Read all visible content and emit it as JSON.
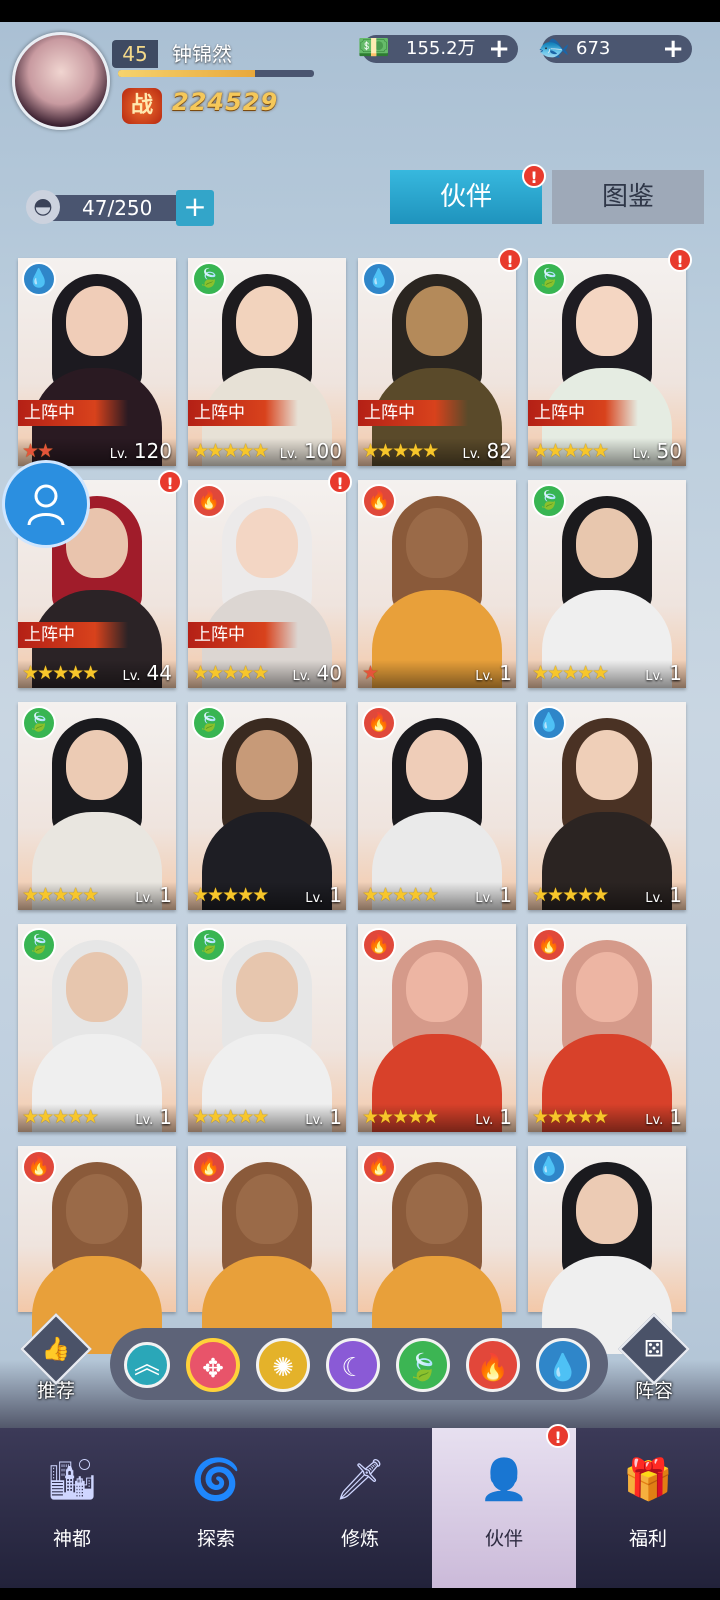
{
  "player": {
    "level": "45",
    "name": "钟锦然",
    "xp_fraction": 0.7,
    "power_icon": "战",
    "power": "224529"
  },
  "currencies": [
    {
      "icon": "cash-icon",
      "glyph": "💵",
      "value": "155.2万",
      "plus": "+"
    },
    {
      "icon": "fish-icon",
      "glyph": "🐟",
      "value": "673",
      "plus": "+"
    }
  ],
  "roster": {
    "count": "47/250",
    "add": "+"
  },
  "tabs": {
    "partner": "伙伴",
    "atlas": "图鉴",
    "partner_badge": "!"
  },
  "element_glyphs": {
    "water": "💧",
    "wood": "🍃",
    "fire": "🔥"
  },
  "deployed_label": "上阵中",
  "lv_prefix": "Lv.",
  "cards": [
    {
      "element": "water",
      "deployed": true,
      "stars": 2,
      "level": "120",
      "badge": false,
      "hair": "#1c1a20",
      "body": "#2a1a22",
      "skin": "#f0cdb8"
    },
    {
      "element": "wood",
      "deployed": true,
      "stars": 5,
      "level": "100",
      "badge": false,
      "hair": "#1d1b1e",
      "body": "#e7e1d6",
      "skin": "#f2d3bd"
    },
    {
      "element": "water",
      "deployed": true,
      "stars": 5,
      "level": "82",
      "badge": true,
      "hair": "#2a2520",
      "body": "#5a4a2a",
      "skin": "#b48a5a"
    },
    {
      "element": "wood",
      "deployed": true,
      "stars": 5,
      "level": "50",
      "badge": true,
      "hair": "#1e1c22",
      "body": "#e5ece2",
      "skin": "#f4d6c2"
    },
    {
      "element": "fire",
      "deployed": true,
      "stars": 5,
      "level": "44",
      "badge": true,
      "hair": "#a01c2a",
      "body": "#2b2326",
      "skin": "#e9c4ad"
    },
    {
      "element": "fire",
      "deployed": true,
      "stars": 5,
      "level": "40",
      "badge": true,
      "hair": "#eceaea",
      "body": "#dcd6d2",
      "skin": "#f3d6c4"
    },
    {
      "element": "fire",
      "deployed": false,
      "stars": 1,
      "level": "1",
      "badge": false,
      "hair": "#8a5a3a",
      "body": "#e8a03a",
      "skin": "#9a6a48"
    },
    {
      "element": "wood",
      "deployed": false,
      "stars": 5,
      "level": "1",
      "badge": false,
      "hair": "#1b1a1d",
      "body": "#efefef",
      "skin": "#e8c7ae"
    },
    {
      "element": "wood",
      "deployed": false,
      "stars": 5,
      "level": "1",
      "badge": false,
      "hair": "#1a1a1e",
      "body": "#e9e6e0",
      "skin": "#eccbb4"
    },
    {
      "element": "wood",
      "deployed": false,
      "stars": 5,
      "level": "1",
      "badge": false,
      "hair": "#3a2a20",
      "body": "#1e1e24",
      "skin": "#c79a78"
    },
    {
      "element": "fire",
      "deployed": false,
      "stars": 5,
      "level": "1",
      "badge": false,
      "hair": "#1b1a1e",
      "body": "#eaeaea",
      "skin": "#efcdb8"
    },
    {
      "element": "water",
      "deployed": false,
      "stars": 5,
      "level": "1",
      "badge": false,
      "hair": "#4a3224",
      "body": "#2b2422",
      "skin": "#efcfb8"
    },
    {
      "element": "wood",
      "deployed": false,
      "stars": 5,
      "level": "1",
      "badge": false,
      "hair": "#e6e6e6",
      "body": "#efefef",
      "skin": "#e7c6ae"
    },
    {
      "element": "wood",
      "deployed": false,
      "stars": 5,
      "level": "1",
      "badge": false,
      "hair": "#e6e6e6",
      "body": "#efefef",
      "skin": "#e7c6ae"
    },
    {
      "element": "fire",
      "deployed": false,
      "stars": 5,
      "level": "1",
      "badge": false,
      "hair": "#d59a8a",
      "body": "#d8412a",
      "skin": "#edb5a3"
    },
    {
      "element": "fire",
      "deployed": false,
      "stars": 5,
      "level": "1",
      "badge": false,
      "hair": "#d59a8a",
      "body": "#d8412a",
      "skin": "#edb5a3"
    },
    {
      "element": "fire",
      "deployed": false,
      "stars": 0,
      "level": "",
      "badge": false,
      "hair": "#8a5a3a",
      "body": "#e8a03a",
      "skin": "#9a6a48"
    },
    {
      "element": "fire",
      "deployed": false,
      "stars": 0,
      "level": "",
      "badge": false,
      "hair": "#8a5a3a",
      "body": "#e8a03a",
      "skin": "#9a6a48"
    },
    {
      "element": "fire",
      "deployed": false,
      "stars": 0,
      "level": "",
      "badge": false,
      "hair": "#8a5a3a",
      "body": "#e8a03a",
      "skin": "#9a6a48"
    },
    {
      "element": "water",
      "deployed": false,
      "stars": 0,
      "level": "",
      "badge": false,
      "hair": "#1a1a1e",
      "body": "#efefef",
      "skin": "#eccbb4"
    }
  ],
  "filters": [
    {
      "name": "filter-up-icon",
      "glyph": "︽",
      "color": "#2aa7b8",
      "selected": false
    },
    {
      "name": "filter-all-icon",
      "glyph": "✥",
      "color": "#e8546a",
      "selected": true
    },
    {
      "name": "filter-light-icon",
      "glyph": "✺",
      "color": "#e4b22a",
      "selected": false
    },
    {
      "name": "filter-moon-icon",
      "glyph": "☾",
      "color": "#8a5ad6",
      "selected": false
    },
    {
      "name": "filter-wood-icon",
      "glyph": "🍃",
      "color": "#3cb553",
      "selected": false
    },
    {
      "name": "filter-fire-icon",
      "glyph": "🔥",
      "color": "#e2473a",
      "selected": false
    },
    {
      "name": "filter-water-icon",
      "glyph": "💧",
      "color": "#2f86c9",
      "selected": false
    }
  ],
  "side_buttons": {
    "recommend": "推荐",
    "lineup": "阵容"
  },
  "nav": [
    {
      "label": "神都",
      "icon": "city-icon",
      "glyph": "🏙",
      "active": false,
      "badge": false
    },
    {
      "label": "探索",
      "icon": "portal-icon",
      "glyph": "🌀",
      "active": false,
      "badge": false
    },
    {
      "label": "修炼",
      "icon": "sword-icon",
      "glyph": "🗡",
      "active": false,
      "badge": false
    },
    {
      "label": "伙伴",
      "icon": "hood-icon",
      "glyph": "👤",
      "active": true,
      "badge": true
    },
    {
      "label": "福利",
      "icon": "chest-icon",
      "glyph": "🎁",
      "active": false,
      "badge": false
    }
  ]
}
